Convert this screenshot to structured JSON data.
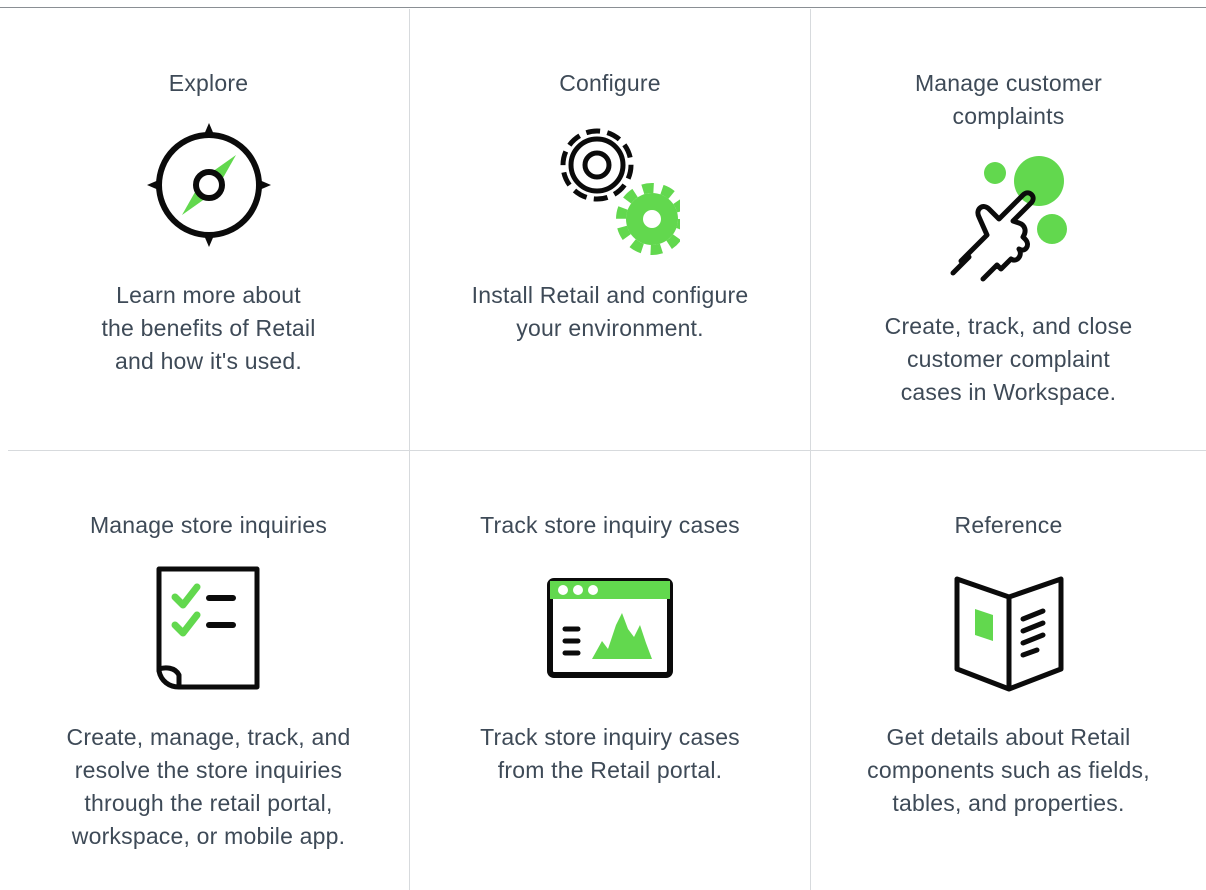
{
  "colors": {
    "accent": "#62d84e",
    "text": "#3e4a57",
    "divider": "#d7dadd",
    "icon_stroke": "#0b0b0b"
  },
  "cards": [
    {
      "title": "Explore",
      "description": "Learn more about\nthe benefits of Retail\nand how it's used.",
      "icon": "compass-icon"
    },
    {
      "title": "Configure",
      "description": "Install Retail and configure\nyour environment.",
      "icon": "gears-icon"
    },
    {
      "title": "Manage customer\ncomplaints",
      "description": "Create, track, and close\ncustomer complaint\ncases in Workspace.",
      "icon": "hand-pointer-icon"
    },
    {
      "title": "Manage store inquiries",
      "description": "Create, manage, track, and\nresolve the store inquiries\nthrough the retail portal,\nworkspace, or mobile app.",
      "icon": "checklist-icon"
    },
    {
      "title": "Track store inquiry cases",
      "description": "Track store inquiry cases\nfrom the Retail portal.",
      "icon": "dashboard-chart-icon"
    },
    {
      "title": "Reference",
      "description": "Get details about Retail\ncomponents such as fields,\ntables, and properties.",
      "icon": "open-book-icon"
    }
  ]
}
